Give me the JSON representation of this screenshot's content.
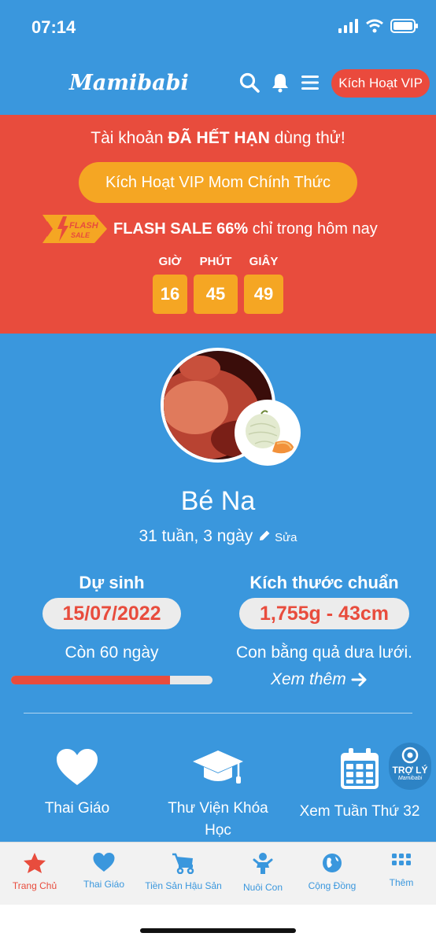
{
  "status_bar": {
    "time": "07:14"
  },
  "header": {
    "logo": "Mamibabi",
    "vip_button": "Kích Hoạt VIP"
  },
  "promo": {
    "expired_prefix": "Tài khoản",
    "expired_emphasis": "ĐÃ HẾT HẠN",
    "expired_suffix": "dùng thử!",
    "activate_button": "Kích Hoạt VIP Mom Chính Thức",
    "flash_badge_line1": "FLASH",
    "flash_badge_line2": "SALE",
    "flash_emphasis": "FLASH SALE 66%",
    "flash_suffix": "chỉ trong hôm nay",
    "countdown": [
      {
        "label": "GIỜ",
        "value": "16"
      },
      {
        "label": "PHÚT",
        "value": "45"
      },
      {
        "label": "GIÂY",
        "value": "49"
      }
    ]
  },
  "profile": {
    "name": "Bé Na",
    "age": "31 tuần, 3 ngày",
    "edit_label": "Sửa",
    "due": {
      "title": "Dự sinh",
      "date": "15/07/2022",
      "remaining": "Còn 60 ngày",
      "progress": 0.79
    },
    "size": {
      "title": "Kích thước chuẩn",
      "value": "1,755g - 43cm",
      "comparison": "Con bằng quả dưa lưới.",
      "more": "Xem thêm"
    }
  },
  "features": [
    {
      "label": "Thai Giáo",
      "icon": "heart-icon"
    },
    {
      "label": "Thư Viện Khóa Học",
      "icon": "graduation-cap-icon"
    },
    {
      "label": "Xem Tuần Thứ 32",
      "icon": "calendar-icon"
    }
  ],
  "assistant": {
    "line1": "TRỢ LÝ",
    "line2": "Mamibabi"
  },
  "tabs": [
    {
      "label": "Trang Chủ",
      "icon": "star-icon",
      "active": true
    },
    {
      "label": "Thai Giáo",
      "icon": "heart-icon"
    },
    {
      "label": "Tiền Sản Hậu Sản",
      "icon": "stroller-icon"
    },
    {
      "label": "Nuôi Con",
      "icon": "baby-icon"
    },
    {
      "label": "Cộng Đồng",
      "icon": "globe-icon"
    },
    {
      "label": "Thêm",
      "icon": "grid-icon"
    }
  ],
  "colors": {
    "primary": "#3a97dd",
    "accent": "#e84c3d",
    "orange": "#f5a623"
  }
}
